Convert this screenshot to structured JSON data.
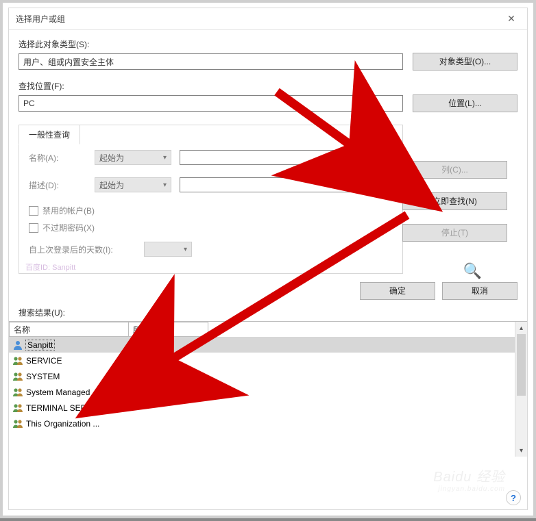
{
  "title": "选择用户或组",
  "objectType": {
    "label": "选择此对象类型(S):",
    "value": "用户、组或内置安全主体",
    "button": "对象类型(O)..."
  },
  "location": {
    "label": "查找位置(F):",
    "value": "PC",
    "button": "位置(L)..."
  },
  "queryTab": "一般性查询",
  "query": {
    "nameLabel": "名称(A):",
    "nameMode": "起始为",
    "descLabel": "描述(D):",
    "descMode": "起始为",
    "disabledAccounts": "禁用的帐户(B)",
    "neverExpire": "不过期密码(X)",
    "daysSinceLogin": "自上次登录后的天数(I):"
  },
  "rightButtons": {
    "columns": "列(C)...",
    "findNow": "立即查找(N)",
    "stop": "停止(T)"
  },
  "footer": {
    "ok": "确定",
    "cancel": "取消"
  },
  "results": {
    "label": "搜索结果(U):",
    "columns": {
      "name": "名称",
      "folder": "所在文件夹"
    },
    "rows": [
      {
        "name": "Sanpitt",
        "folder": "PC",
        "icon": "user",
        "selected": true
      },
      {
        "name": "SERVICE",
        "folder": "",
        "icon": "group"
      },
      {
        "name": "SYSTEM",
        "folder": "",
        "icon": "group"
      },
      {
        "name": "System Managed ...",
        "folder": "PC",
        "icon": "group"
      },
      {
        "name": "TERMINAL SERVE...",
        "folder": "",
        "icon": "group"
      },
      {
        "name": "This Organization ...",
        "folder": "",
        "icon": "group"
      }
    ]
  },
  "watermark": "百度ID: Sanpitt",
  "baidu": "Baidu 经验"
}
